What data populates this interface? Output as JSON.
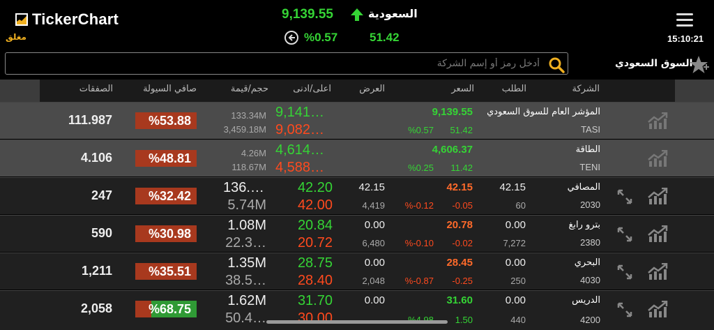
{
  "app": {
    "name": "TickerChart",
    "market_status": "مغلق",
    "clock": "15:10:21"
  },
  "index": {
    "name": "السعودية",
    "value": "9,139.55",
    "percent": "%0.57",
    "change": "51.42",
    "color": "#35d435"
  },
  "search": {
    "placeholder": "أدخل رمز أو إسم الشركة",
    "market": "السوق السعودي"
  },
  "columns": {
    "company": "الشركة",
    "bid": "الطلب",
    "price": "السعر",
    "ask": "العرض",
    "high_low": "اعلى/ادنى",
    "volume_value": "حجم/قيمة",
    "net_liquidity": "صافي السيولة",
    "deals": "الصفقات"
  },
  "rows": [
    {
      "name": "المؤشر العام للسوق السعودي",
      "code": "TASI",
      "price": "9,139.55",
      "pct": "%0.57",
      "change": "51.42",
      "high": "9,141…",
      "low": "9,082…",
      "volume": "133.34M",
      "value": "3,459.18M",
      "liquidity": "%53.88",
      "deals": "111.987"
    },
    {
      "name": "الطاقة",
      "code": "TENI",
      "price": "4,606.37",
      "pct": "%0.25",
      "change": "11.42",
      "high": "4,614…",
      "low": "4,588…",
      "volume": "4.26M",
      "value": "118.67M",
      "liquidity": "%48.81",
      "deals": "4.106"
    },
    {
      "name": "المصافي",
      "code": "2030",
      "bid": "42.15",
      "bid_qty": "60",
      "price": "42.15",
      "change": "-0.05",
      "pct": "%-0.12",
      "ask": "42.15",
      "ask_qty": "4,419",
      "high": "42.20",
      "low": "42.00",
      "volume": "136.…",
      "value": "5.74M",
      "liquidity": "%32.42",
      "deals": "247"
    },
    {
      "name": "بترو رابغ",
      "code": "2380",
      "bid": "0.00",
      "bid_qty": "7,272",
      "price": "20.78",
      "change": "-0.02",
      "pct": "%-0.10",
      "ask": "0.00",
      "ask_qty": "6,480",
      "high": "20.84",
      "low": "20.72",
      "volume": "1.08M",
      "value": "22.3…",
      "liquidity": "%30.98",
      "deals": "590"
    },
    {
      "name": "البحري",
      "code": "4030",
      "bid": "0.00",
      "bid_qty": "250",
      "price": "28.45",
      "change": "-0.25",
      "pct": "%-0.87",
      "ask": "0.00",
      "ask_qty": "2,048",
      "high": "28.75",
      "low": "28.40",
      "volume": "1.35M",
      "value": "38.5…",
      "liquidity": "%35.51",
      "deals": "1,211"
    },
    {
      "name": "الدريس",
      "code": "4200",
      "bid": "0.00",
      "bid_qty": "440",
      "price": "31.60",
      "change": "1.50",
      "pct": "%4.98",
      "ask": "0.00",
      "ask_qty": "",
      "high": "31.70",
      "low": "30.00",
      "volume": "1.62M",
      "value": "50.4…",
      "liquidity": "%68.75",
      "deals": "2,058"
    }
  ],
  "icons": {
    "chart": "chart-line-icon",
    "expand": "expand-icon",
    "star": "star-icon",
    "search": "search-icon",
    "menu": "hamburger-menu-icon",
    "back": "circle-arrow-left-icon"
  },
  "colors": {
    "up": "#35d435",
    "down": "#ff4a1e",
    "liquidity_negative_bg": "#a8391e",
    "liquidity_positive_bg": "#2f9a35"
  }
}
